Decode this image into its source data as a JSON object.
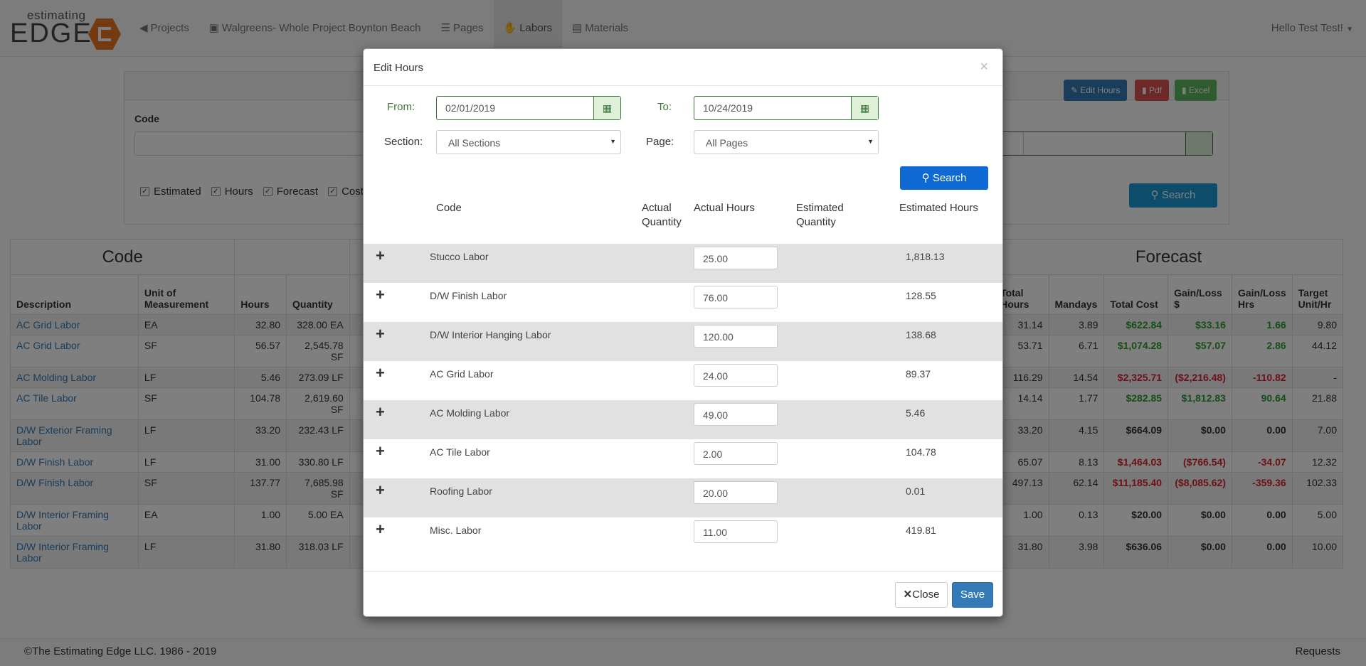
{
  "brand": {
    "top": "estimating",
    "bottom": "EDGE"
  },
  "nav": {
    "projects": "Projects",
    "project_name": "Walgreens- Whole Project Boynton Beach",
    "pages": "Pages",
    "labors": "Labors",
    "materials": "Materials",
    "user": "Hello Test Test!"
  },
  "panel": {
    "edit_hours": "Edit Hours",
    "pdf": "Pdf",
    "excel": "Excel",
    "code_label": "Code",
    "search": "Search",
    "checks": [
      "Estimated",
      "Hours",
      "Forecast",
      "Cost"
    ]
  },
  "table": {
    "group_code": "Code",
    "group_forecast": "Forecast",
    "headers": {
      "description": "Description",
      "unit": "Unit of Measurement",
      "hours": "Hours",
      "quantity": "Quantity",
      "total_hours": "Total Hours",
      "mandays": "Mandays",
      "total_cost": "Total Cost",
      "gain_loss_usd": "Gain/Loss $",
      "gain_loss_hrs": "Gain/Loss Hrs",
      "target": "Target Unit/Hr"
    },
    "rows": [
      {
        "desc": "AC Grid Labor",
        "unit": "EA",
        "hours": "32.80",
        "qty": "328.00 EA",
        "th": "31.14",
        "md": "3.89",
        "tc": "$622.84",
        "tcc": "green",
        "gl": "$33.16",
        "glc": "green",
        "gh": "1.66",
        "ghc": "green",
        "t": "9.80"
      },
      {
        "desc": "AC Grid Labor",
        "unit": "SF",
        "hours": "56.57",
        "qty": "2,545.78 SF",
        "th": "53.71",
        "md": "6.71",
        "tc": "$1,074.28",
        "tcc": "green",
        "gl": "$57.07",
        "glc": "green",
        "gh": "2.86",
        "ghc": "green",
        "t": "44.12"
      },
      {
        "desc": "AC Molding Labor",
        "unit": "LF",
        "hours": "5.46",
        "qty": "273.09 LF",
        "th": "116.29",
        "md": "14.54",
        "tc": "$2,325.71",
        "tcc": "red",
        "gl": "($2,216.48)",
        "glc": "red",
        "gh": "-110.82",
        "ghc": "red",
        "t": "-"
      },
      {
        "desc": "AC Tile Labor",
        "unit": "SF",
        "hours": "104.78",
        "qty": "2,619.60 SF",
        "th": "14.14",
        "md": "1.77",
        "tc": "$282.85",
        "tcc": "green",
        "gl": "$1,812.83",
        "glc": "green",
        "gh": "90.64",
        "ghc": "green",
        "t": "21.88"
      },
      {
        "desc": "D/W Exterior Framing Labor",
        "unit": "LF",
        "hours": "33.20",
        "qty": "232.43 LF",
        "th": "33.20",
        "md": "4.15",
        "tc": "$664.09",
        "tcc": "black",
        "gl": "$0.00",
        "glc": "black",
        "gh": "0.00",
        "ghc": "black",
        "t": "7.00"
      },
      {
        "desc": "D/W Finish Labor",
        "unit": "LF",
        "hours": "31.00",
        "qty": "330.80 LF",
        "th": "65.07",
        "md": "8.13",
        "tc": "$1,464.03",
        "tcc": "red",
        "gl": "($766.54)",
        "glc": "red",
        "gh": "-34.07",
        "ghc": "red",
        "t": "12.32"
      },
      {
        "desc": "D/W Finish Labor",
        "unit": "SF",
        "hours": "137.77",
        "qty": "7,685.98 SF",
        "th": "497.13",
        "md": "62.14",
        "tc": "$11,185.40",
        "tcc": "red",
        "gl": "($8,085.62)",
        "glc": "red",
        "gh": "-359.36",
        "ghc": "red",
        "t": "102.33"
      },
      {
        "desc": "D/W Interior Framing Labor",
        "unit": "EA",
        "hours": "1.00",
        "qty": "5.00 EA",
        "th": "1.00",
        "md": "0.13",
        "tc": "$20.00",
        "tcc": "black",
        "gl": "$0.00",
        "glc": "black",
        "gh": "0.00",
        "ghc": "black",
        "t": "5.00"
      },
      {
        "desc": "D/W Interior Framing Labor",
        "unit": "LF",
        "hours": "31.80",
        "qty": "318.03 LF",
        "th": "31.80",
        "md": "3.98",
        "tc": "$636.06",
        "tcc": "black",
        "gl": "$0.00",
        "glc": "black",
        "gh": "0.00",
        "ghc": "black",
        "t": "10.00"
      }
    ]
  },
  "footer": {
    "copyright": "©The Estimating Edge LLC. 1986 - 2019",
    "requests": "Requests"
  },
  "modal": {
    "title": "Edit Hours",
    "close_x": "×",
    "from_label": "From:",
    "from_value": "02/01/2019",
    "to_label": "To:",
    "to_value": "10/24/2019",
    "section_label": "Section:",
    "section_value": "All Sections",
    "page_label": "Page:",
    "page_value": "All Pages",
    "search": "Search",
    "col_code": "Code",
    "col_actual_qty": "Actual Quantity",
    "col_actual_hours": "Actual Hours",
    "col_est_qty": "Estimated Quantity",
    "col_est_hours": "Estimated Hours",
    "rows": [
      {
        "name": "Stucco Labor",
        "actual": "25.00",
        "est": "1,818.13"
      },
      {
        "name": "D/W Finish Labor",
        "actual": "76.00",
        "est": "128.55"
      },
      {
        "name": "D/W Interior Hanging Labor",
        "actual": "120.00",
        "est": "138.68"
      },
      {
        "name": "AC Grid Labor",
        "actual": "24.00",
        "est": "89.37"
      },
      {
        "name": "AC Molding Labor",
        "actual": "49.00",
        "est": "5.46"
      },
      {
        "name": "AC Tile Labor",
        "actual": "2.00",
        "est": "104.78"
      },
      {
        "name": "Roofing Labor",
        "actual": "20.00",
        "est": "0.01"
      },
      {
        "name": "Misc. Labor",
        "actual": "11.00",
        "est": "419.81"
      }
    ],
    "close_btn": "Close",
    "save_btn": "Save"
  }
}
